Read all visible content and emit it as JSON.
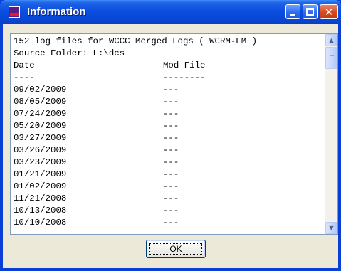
{
  "window": {
    "title": "Information",
    "icon": "app-logo-icon",
    "colors": {
      "titlebar": "#0a4ee0",
      "frame": "#0a3fd6",
      "client": "#ece9d8",
      "close": "#d6491f"
    }
  },
  "content": {
    "lines": [
      "152 log files for WCCC Merged Logs ( WCRM-FM )",
      "Source Folder: L:\\dcs"
    ],
    "columns": {
      "date": "Date",
      "mod": "Mod File"
    },
    "separators": {
      "date": "----",
      "mod": "--------"
    },
    "rows": [
      {
        "date": "09/02/2009",
        "mod": "---"
      },
      {
        "date": "08/05/2009",
        "mod": "---"
      },
      {
        "date": "07/24/2009",
        "mod": "---"
      },
      {
        "date": "05/20/2009",
        "mod": "---"
      },
      {
        "date": "03/27/2009",
        "mod": "---"
      },
      {
        "date": "03/26/2009",
        "mod": "---"
      },
      {
        "date": "03/23/2009",
        "mod": "---"
      },
      {
        "date": "01/21/2009",
        "mod": "---"
      },
      {
        "date": "01/02/2009",
        "mod": "---"
      },
      {
        "date": "11/21/2008",
        "mod": "---"
      },
      {
        "date": "10/13/2008",
        "mod": "---"
      },
      {
        "date": "10/10/2008",
        "mod": "---"
      }
    ]
  },
  "buttons": {
    "ok_label": "OK"
  }
}
